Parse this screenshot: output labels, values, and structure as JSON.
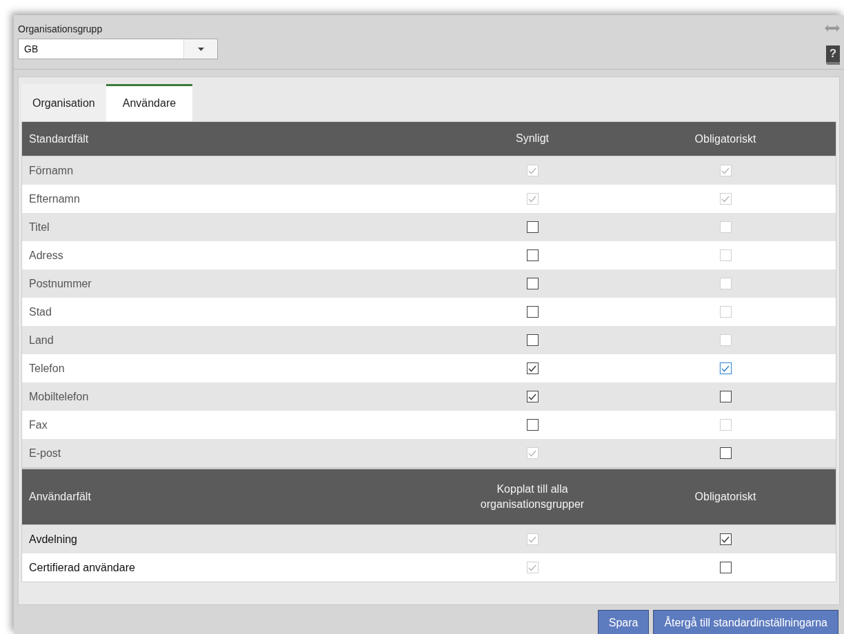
{
  "org_group": {
    "label": "Organisationsgrupp",
    "value": "GB"
  },
  "tabs": [
    {
      "label": "Organisation",
      "selected": false
    },
    {
      "label": "Användare",
      "selected": true
    }
  ],
  "sections": [
    {
      "columns": [
        "Standardfält",
        "Synligt",
        "Obligatoriskt"
      ],
      "rows": [
        {
          "label": "Förnamn",
          "col_1": {
            "checked": true,
            "disabled": true,
            "focused": false
          },
          "col_2": {
            "checked": true,
            "disabled": true,
            "focused": false
          }
        },
        {
          "label": "Efternamn",
          "col_1": {
            "checked": true,
            "disabled": true,
            "focused": false
          },
          "col_2": {
            "checked": true,
            "disabled": true,
            "focused": false
          }
        },
        {
          "label": "Titel",
          "col_1": {
            "checked": false,
            "disabled": false,
            "focused": false
          },
          "col_2": {
            "checked": false,
            "disabled": true,
            "focused": false
          }
        },
        {
          "label": "Adress",
          "col_1": {
            "checked": false,
            "disabled": false,
            "focused": false
          },
          "col_2": {
            "checked": false,
            "disabled": true,
            "focused": false
          }
        },
        {
          "label": "Postnummer",
          "col_1": {
            "checked": false,
            "disabled": false,
            "focused": false
          },
          "col_2": {
            "checked": false,
            "disabled": true,
            "focused": false
          }
        },
        {
          "label": "Stad",
          "col_1": {
            "checked": false,
            "disabled": false,
            "focused": false
          },
          "col_2": {
            "checked": false,
            "disabled": true,
            "focused": false
          }
        },
        {
          "label": "Land",
          "col_1": {
            "checked": false,
            "disabled": false,
            "focused": false
          },
          "col_2": {
            "checked": false,
            "disabled": true,
            "focused": false
          }
        },
        {
          "label": "Telefon",
          "col_1": {
            "checked": true,
            "disabled": false,
            "focused": false
          },
          "col_2": {
            "checked": true,
            "disabled": false,
            "focused": true
          }
        },
        {
          "label": "Mobiltelefon",
          "col_1": {
            "checked": true,
            "disabled": false,
            "focused": false
          },
          "col_2": {
            "checked": false,
            "disabled": false,
            "focused": false
          }
        },
        {
          "label": "Fax",
          "col_1": {
            "checked": false,
            "disabled": false,
            "focused": false
          },
          "col_2": {
            "checked": false,
            "disabled": true,
            "focused": false
          }
        },
        {
          "label": "E-post",
          "col_1": {
            "checked": true,
            "disabled": true,
            "focused": false
          },
          "col_2": {
            "checked": false,
            "disabled": false,
            "focused": false
          }
        }
      ]
    },
    {
      "columns": [
        "Användarfält",
        "Kopplat till alla organisationsgrupper",
        "Obligatoriskt"
      ],
      "rows": [
        {
          "label": "Avdelning",
          "col_1": {
            "checked": true,
            "disabled": true,
            "focused": false
          },
          "col_2": {
            "checked": true,
            "disabled": false,
            "focused": false
          }
        },
        {
          "label": "Certifierad användare",
          "col_1": {
            "checked": true,
            "disabled": true,
            "focused": false
          },
          "col_2": {
            "checked": false,
            "disabled": false,
            "focused": false
          }
        }
      ]
    }
  ],
  "help_button": "?",
  "buttons": [
    "Spara",
    "Återgå till standardinställningarna"
  ]
}
